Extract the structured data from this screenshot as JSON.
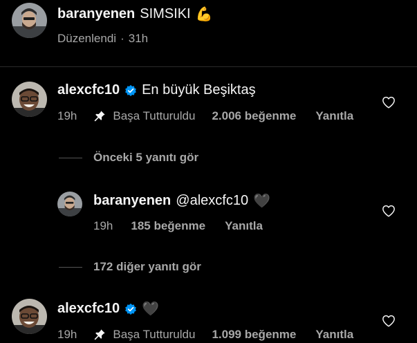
{
  "top_comment": {
    "username": "baranyenen",
    "text": "SIMSIKI",
    "emoji": "💪",
    "edited_label": "Düzenlendi",
    "separator": "·",
    "time": "31h"
  },
  "comment_1": {
    "username": "alexcfc10",
    "text": "En büyük Beşiktaş",
    "time": "19h",
    "pinned_label": "Başa Tutturuldu",
    "likes": "2.006 beğenme",
    "reply_label": "Yanıtla"
  },
  "view_previous": "Önceki 5 yanıtı gör",
  "reply_1": {
    "username": "baranyenen",
    "text": "@alexcfc10",
    "emoji": "🖤",
    "time": "19h",
    "likes": "185 beğenme",
    "reply_label": "Yanıtla"
  },
  "view_more": "172 diğer yanıtı gör",
  "comment_2": {
    "username": "alexcfc10",
    "emoji": "🖤",
    "time": "19h",
    "pinned_label": "Başa Tutturuldu",
    "likes": "1.099 beğenme",
    "reply_label": "Yanıtla"
  },
  "colors": {
    "background": "#000000",
    "text_primary": "#f5f5f5",
    "text_secondary": "#a8a8a8",
    "verified_blue": "#0095f6"
  },
  "icons": [
    "heart-outline-icon",
    "pin-icon",
    "verified-badge-icon"
  ]
}
